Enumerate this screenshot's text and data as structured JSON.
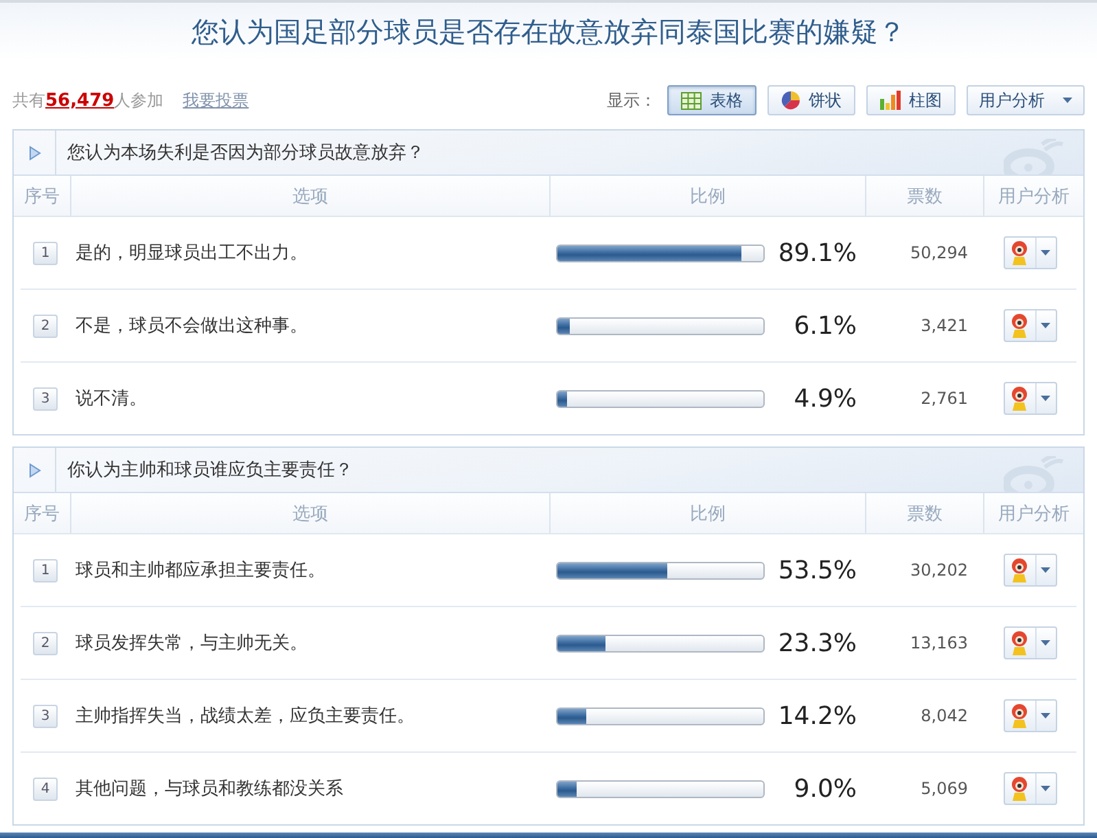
{
  "title": "您认为国足部分球员是否存在故意放弃同泰国比赛的嫌疑？",
  "summary": {
    "text": "共有**56,479**人参加",
    "vote_link": "我要投票"
  },
  "display": {
    "label": "显示：",
    "views": [
      {
        "kind": "table",
        "label": "表格",
        "selected": true
      },
      {
        "kind": "pie",
        "label": "饼状",
        "selected": false
      },
      {
        "kind": "bar",
        "label": "柱图",
        "selected": false
      }
    ],
    "analysis_menu": "用户分析"
  },
  "sections": [
    {
      "title": "您认为本场失利是否因为部分球员故意放弃？",
      "columns": [
        "序号",
        "选项",
        "比例",
        "票数",
        "用户分析"
      ],
      "rows": [
        {
          "index": "1",
          "option": "是的，明显球员出工不出力。",
          "level": 0.891,
          "percent": "89.1%",
          "votes": "50,294"
        },
        {
          "index": "2",
          "option": "不是，球员不会做出这种事。",
          "level": 0.061,
          "percent": "6.1%",
          "votes": "3,421"
        },
        {
          "index": "3",
          "option": "说不清。",
          "level": 0.049,
          "percent": "4.9%",
          "votes": "2,761"
        }
      ]
    },
    {
      "title": "你认为主帅和球员谁应负主要责任？",
      "columns": [
        "序号",
        "选项",
        "比例",
        "票数",
        "用户分析"
      ],
      "rows": [
        {
          "index": "1",
          "option": "球员和主帅都应承担主要责任。",
          "level": 0.535,
          "percent": "53.5%",
          "votes": "30,202"
        },
        {
          "index": "2",
          "option": "球员发挥失常，与主帅无关。",
          "level": 0.233,
          "percent": "23.3%",
          "votes": "13,163"
        },
        {
          "index": "3",
          "option": "主帅指挥失当，战绩太差，应负主要责任。",
          "level": 0.142,
          "percent": "14.2%",
          "votes": "8,042"
        },
        {
          "index": "4",
          "option": "其他问题，与球员和教练都没关系",
          "level": 0.09,
          "percent": "9.0%",
          "votes": "5,069"
        }
      ]
    }
  ]
}
